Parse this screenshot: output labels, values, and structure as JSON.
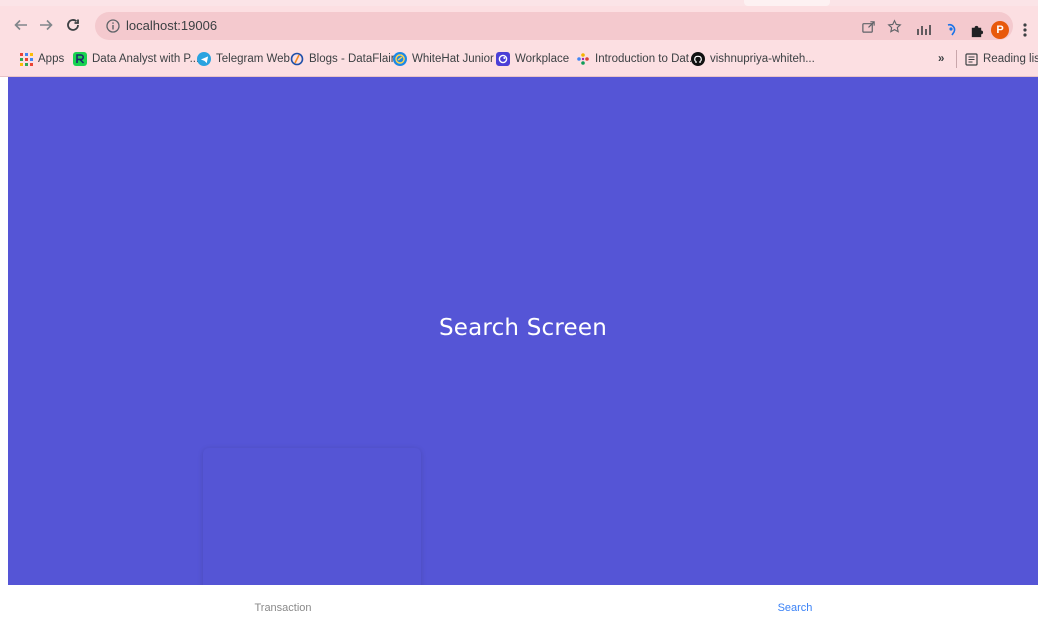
{
  "browser": {
    "url": "localhost:19006",
    "bookmarks": [
      {
        "label": "Apps",
        "icon": "apps-grid-icon"
      },
      {
        "label": "Data Analyst with P...",
        "icon": "r-logo-icon"
      },
      {
        "label": "Telegram Web",
        "icon": "telegram-icon"
      },
      {
        "label": "Blogs - DataFlair",
        "icon": "dataflair-icon"
      },
      {
        "label": "WhiteHat Junior",
        "icon": "whitehat-icon"
      },
      {
        "label": "Workplace",
        "icon": "workplace-icon"
      },
      {
        "label": "Introduction to Dat...",
        "icon": "flower-icon"
      },
      {
        "label": "vishnupriya-whiteh...",
        "icon": "github-icon"
      }
    ],
    "overflow_label": "»",
    "reading_list_label": "Reading list",
    "profile_initial": "P"
  },
  "app": {
    "screen_title": "Search Screen",
    "background_color": "#5555d6",
    "tabs": [
      {
        "label": "Transaction",
        "active": false
      },
      {
        "label": "Search",
        "active": true,
        "color": "#3b82f6"
      }
    ]
  }
}
